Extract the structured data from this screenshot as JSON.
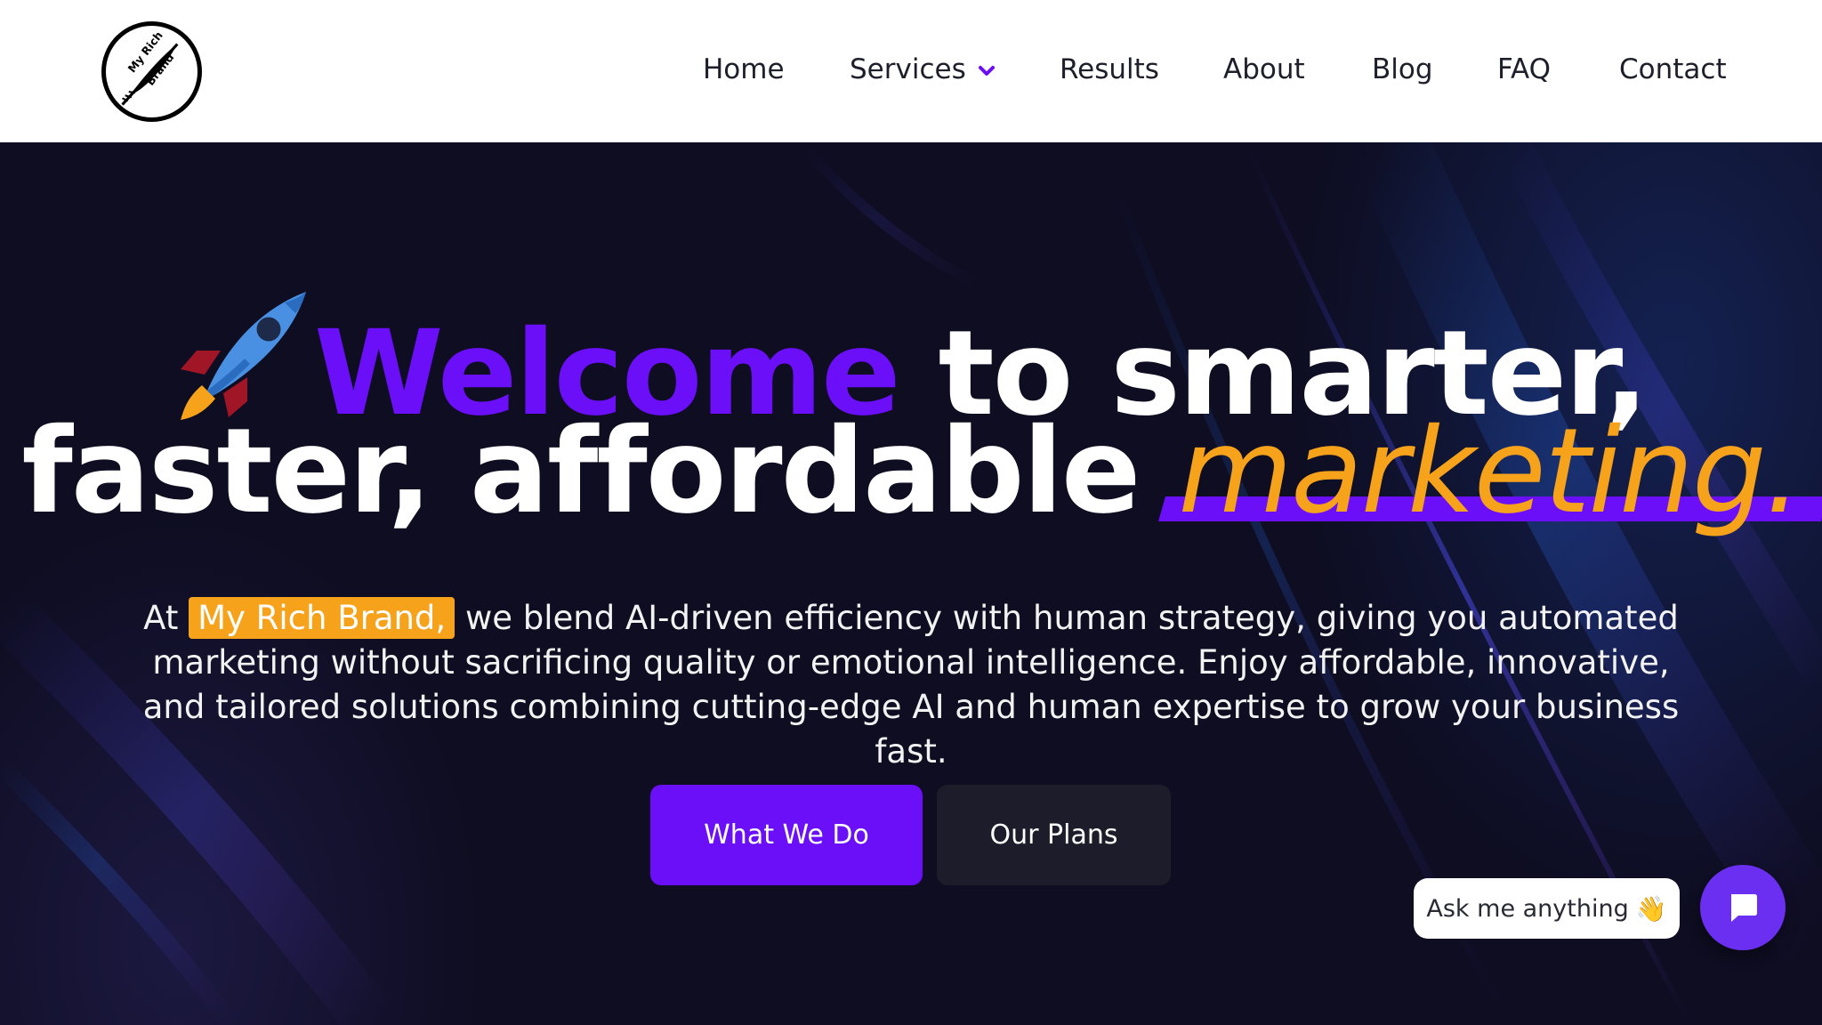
{
  "brand": {
    "logo_text_line1": "My Rich",
    "logo_text_line2": "Brand",
    "logo_icon": "feather-icon"
  },
  "nav": {
    "items": [
      {
        "label": "Home"
      },
      {
        "label": "Services",
        "icon": "chevron-down-icon"
      },
      {
        "label": "Results"
      },
      {
        "label": "About"
      },
      {
        "label": "Blog"
      },
      {
        "label": "FAQ"
      },
      {
        "label": "Contact"
      }
    ]
  },
  "hero": {
    "rocket_icon": "rocket-icon",
    "headline_welcome": "Welcome",
    "headline_rest1": " to smarter,",
    "headline_line2": "faster, affordable ",
    "headline_marketing": "marketing.",
    "paragraph_before": "At ",
    "paragraph_brand": "My Rich Brand,",
    "paragraph_after": " we blend AI-driven efficiency with human strategy, giving you automated marketing without sacrificing quality or emotional intelligence. Enjoy affordable, innovative, and tailored solutions combining cutting-edge AI and human expertise to grow your business fast.",
    "primary_button": "What We Do",
    "secondary_button": "Our Plans"
  },
  "chat": {
    "bubble_text": "Ask me anything",
    "bubble_emoji": "👋",
    "button_icon": "chat-bubble-icon"
  },
  "colors": {
    "accent_purple": "#6a0ff7",
    "accent_orange": "#f7a21b",
    "hero_background": "#0e0d21",
    "nav_background": "#ffffff"
  }
}
